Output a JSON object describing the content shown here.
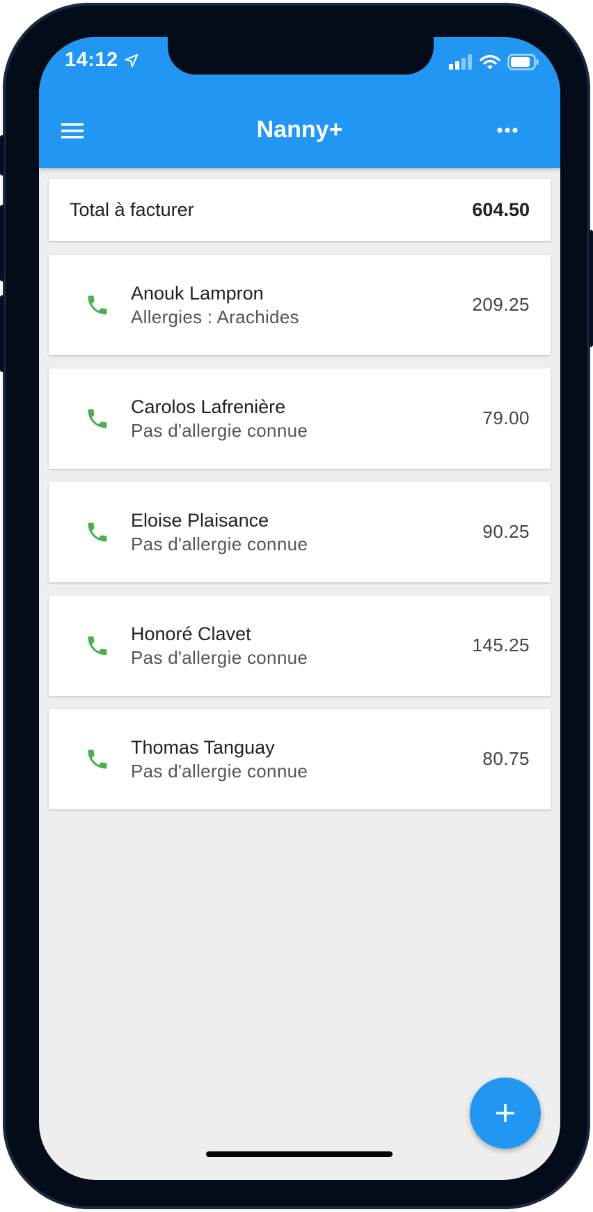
{
  "status_bar": {
    "time": "14:12"
  },
  "app_bar": {
    "title": "Nanny+"
  },
  "summary": {
    "label": "Total à facturer",
    "value": "604.50"
  },
  "children": [
    {
      "name": "Anouk Lampron",
      "note": "Allergies : Arachides",
      "amount": "209.25"
    },
    {
      "name": "Carolos Lafrenière",
      "note": "Pas d'allergie connue",
      "amount": "79.00"
    },
    {
      "name": "Eloise Plaisance",
      "note": "Pas d'allergie connue",
      "amount": "90.25"
    },
    {
      "name": "Honoré Clavet",
      "note": "Pas d'allergie connue",
      "amount": "145.25"
    },
    {
      "name": "Thomas Tanguay",
      "note": "Pas d'allergie connue",
      "amount": "80.75"
    }
  ],
  "icons": {
    "menu": "hamburger-menu-icon",
    "more": "more-horizontal-icon",
    "call": "phone-icon",
    "fab": "plus-icon"
  },
  "colors": {
    "primary": "#2196f3",
    "call_icon": "#4caf50",
    "background": "#eeeeee",
    "card": "#ffffff"
  }
}
